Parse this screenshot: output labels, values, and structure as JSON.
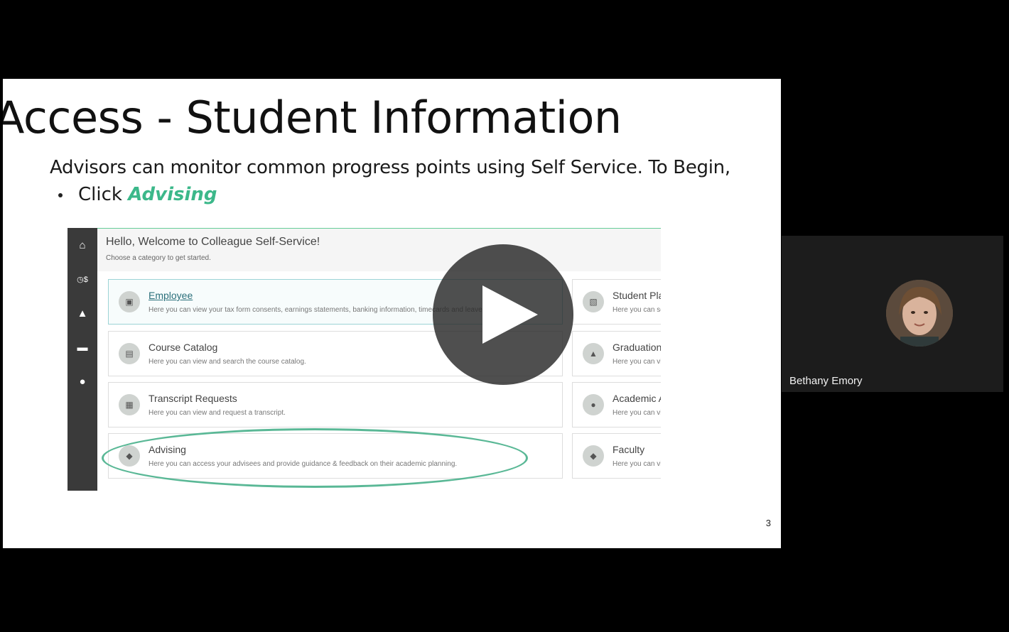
{
  "slide": {
    "title": "Access - Student Information",
    "subtitle": "Advisors can monitor common progress points using Self Service.  To Begin,",
    "bullet_prefix": "Click ",
    "bullet_emphasis": "Advising",
    "page_number": "3"
  },
  "screenshot": {
    "hello": "Hello, Welcome to Colleague Self-Service!",
    "choose": "Choose a category to get started.",
    "sidebar_icons": [
      "home-icon",
      "finance-icon",
      "graduation-cap-icon",
      "briefcase-icon",
      "user-icon"
    ],
    "cards": [
      {
        "title": "Employee",
        "desc": "Here you can view your tax form consents, earnings statements, banking information, timecards and leave balances."
      },
      {
        "title": "Course Catalog",
        "desc": "Here you can view and search the course catalog."
      },
      {
        "title": "Transcript Requests",
        "desc": "Here you can view and request a transcript."
      },
      {
        "title": "Advising",
        "desc": "Here you can access your advisees and provide guidance & feedback on their academic planning."
      }
    ],
    "right_cards": [
      {
        "title": "Student Pla",
        "desc": "Here you can se"
      },
      {
        "title": "Graduation",
        "desc": "Here you can vi"
      },
      {
        "title": "Academic A",
        "desc": "Here you can vi"
      },
      {
        "title": "Faculty",
        "desc": "Here you can vi"
      }
    ]
  },
  "player": {
    "play_icon": "play-icon"
  },
  "participant": {
    "name": "Bethany Emory"
  }
}
